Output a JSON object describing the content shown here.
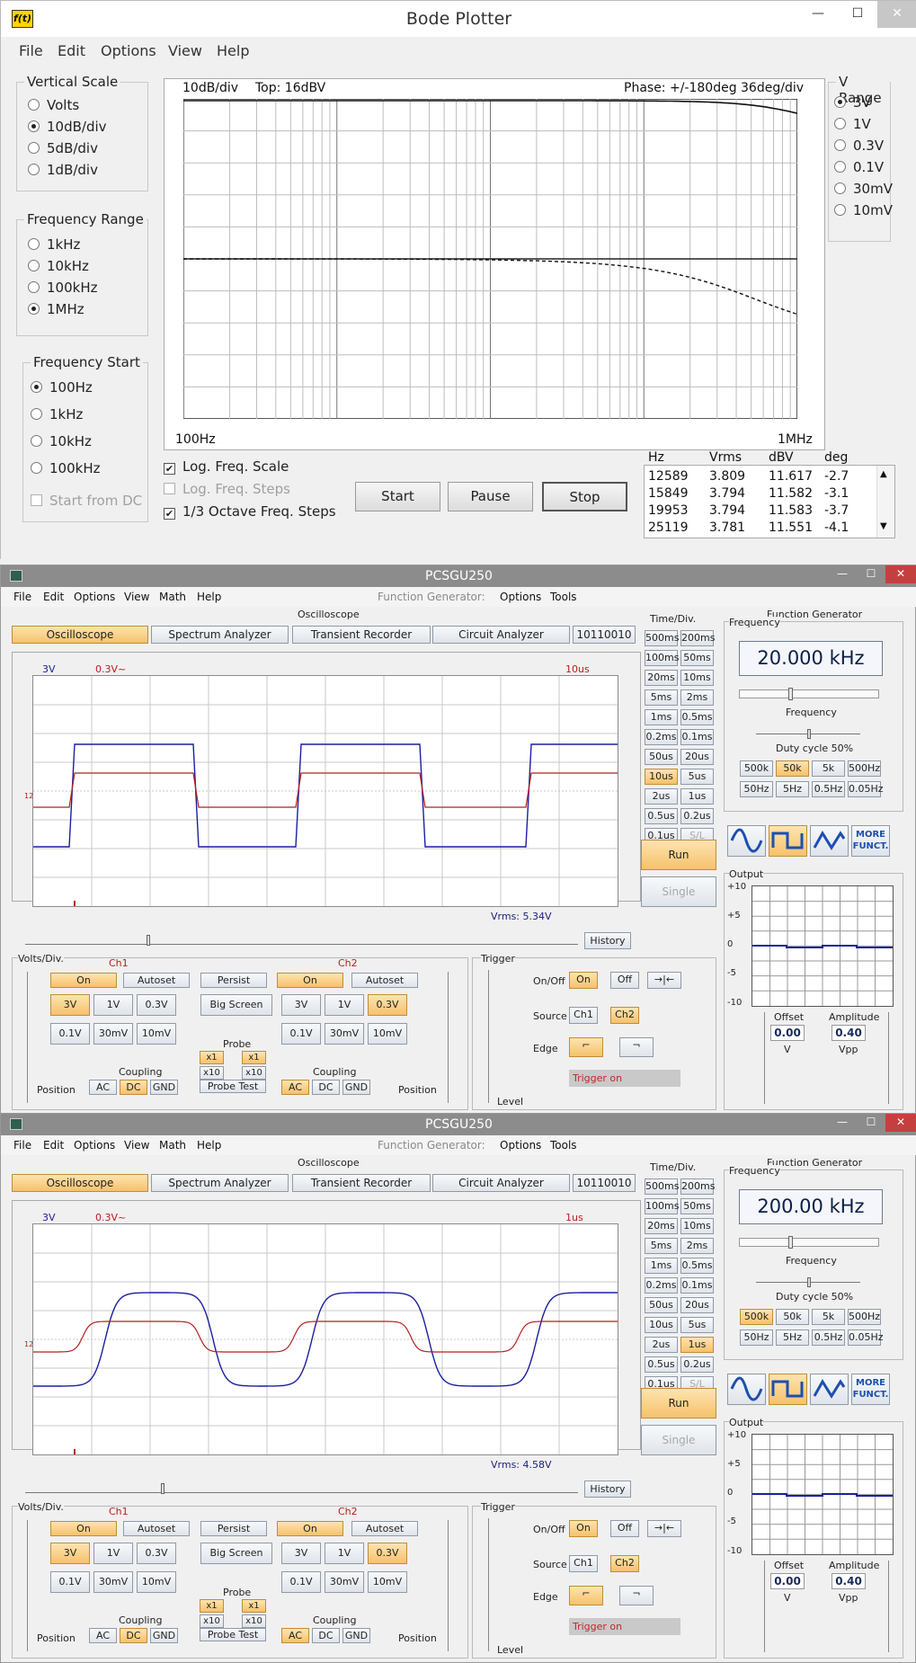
{
  "bode": {
    "title": "Bode Plotter",
    "icon_label": "f(t)",
    "window_buttons": {
      "minimize": "—",
      "maximize": "☐",
      "close": "✕"
    },
    "menu": [
      "File",
      "Edit",
      "Options",
      "View",
      "Help"
    ],
    "vertical_scale": {
      "label": "Vertical Scale",
      "options": [
        "Volts",
        "10dB/div",
        "5dB/div",
        "1dB/div"
      ],
      "selected": 1
    },
    "frequency_range": {
      "label": "Frequency Range",
      "options": [
        "1kHz",
        "10kHz",
        "100kHz",
        "1MHz"
      ],
      "selected": 3
    },
    "frequency_start": {
      "label": "Frequency Start",
      "options": [
        "100Hz",
        "1kHz",
        "10kHz",
        "100kHz"
      ],
      "selected": 0,
      "start_from_dc": "Start from DC"
    },
    "v_range": {
      "label": "V Range",
      "options": [
        "3V",
        "1V",
        "0.3V",
        "0.1V",
        "30mV",
        "10mV"
      ],
      "selected": 0
    },
    "plot": {
      "scale_text": "10dB/div",
      "top_text": "Top:  16dBV",
      "phase_text": "Phase: +/-180deg  36deg/div",
      "x_start": "100Hz",
      "x_end": "1MHz"
    },
    "checks": [
      {
        "label": "Log. Freq. Scale",
        "checked": true,
        "disabled": false
      },
      {
        "label": "Log. Freq. Steps",
        "checked": false,
        "disabled": true
      },
      {
        "label": "1/3 Octave Freq. Steps",
        "checked": true,
        "disabled": false
      }
    ],
    "buttons": {
      "start": "Start",
      "pause": "Pause",
      "stop": "Stop"
    },
    "table": {
      "headers": [
        "Hz",
        "Vrms",
        "dBV",
        "deg"
      ],
      "rows": [
        [
          "12589",
          "3.809",
          "11.617",
          "-2.7"
        ],
        [
          "15849",
          "3.794",
          "11.582",
          "-3.1"
        ],
        [
          "19953",
          "3.794",
          "11.583",
          "-3.7"
        ],
        [
          "25119",
          "3.781",
          "11.551",
          "-4.1"
        ]
      ]
    }
  },
  "pcs_common": {
    "title": "PCSGU250",
    "window_buttons": {
      "minimize": "—",
      "maximize": "☐",
      "close": "✕"
    },
    "menu": [
      "File",
      "Edit",
      "Options",
      "View",
      "Math",
      "Help"
    ],
    "fg_menu_label": "Function Generator:",
    "fg_menu": [
      "Options",
      "Tools"
    ],
    "osc_label": "Oscilloscope",
    "mode_buttons": [
      "Oscilloscope",
      "Spectrum Analyzer",
      "Transient Recorder",
      "Circuit Analyzer",
      "10110010"
    ],
    "timediv_label": "Time/Div.",
    "timediv": [
      [
        "500ms",
        "200ms"
      ],
      [
        "100ms",
        "50ms"
      ],
      [
        "20ms",
        "10ms"
      ],
      [
        "5ms",
        "2ms"
      ],
      [
        "1ms",
        "0.5ms"
      ],
      [
        "0.2ms",
        "0.1ms"
      ],
      [
        "50us",
        "20us"
      ],
      [
        "10us",
        "5us"
      ],
      [
        "2us",
        "1us"
      ],
      [
        "0.5us",
        "0.2us"
      ],
      [
        "0.1us",
        "S/L"
      ]
    ],
    "run": "Run",
    "single": "Single",
    "history": "History",
    "ch1_scale": "3V",
    "ch2_scale": "0.3V~",
    "volts_div": "Volts/Div.",
    "ch1": "Ch1",
    "ch2": "Ch2",
    "on": "On",
    "autoset": "Autoset",
    "persist": "Persist",
    "big_screen": "Big Screen",
    "volt_row1": [
      "3V",
      "1V",
      "0.3V"
    ],
    "volt_row2": [
      "0.1V",
      "30mV",
      "10mV"
    ],
    "probe": "Probe",
    "x1": "x1",
    "x10": "x10",
    "probe_test": "Probe Test",
    "coupling": "Coupling",
    "ac": "AC",
    "dc": "DC",
    "gnd": "GND",
    "position": "Position",
    "trigger": "Trigger",
    "onoff": "On/Off",
    "off": "Off",
    "source": "Source",
    "edge": "Edge",
    "level": "Level",
    "trigger_on": "Trigger on",
    "fg_title": "Function Generator",
    "frequency": "Frequency",
    "freq_slider_label": "Frequency",
    "duty": "Duty cycle 50%",
    "range_row1": [
      "500k",
      "50k",
      "5k",
      "500Hz"
    ],
    "range_row2": [
      "50Hz",
      "5Hz",
      "0.5Hz",
      "0.05Hz"
    ],
    "more": "MORE\nFUNCT.",
    "output": "Output",
    "output_ticks": [
      "+10",
      "+5",
      "0",
      "-5",
      "-10"
    ],
    "offset": "Offset",
    "offset_val": "0.00",
    "offset_unit": "V",
    "amplitude": "Amplitude",
    "amplitude_val": "0.40",
    "amplitude_unit": "Vpp",
    "colors": {
      "ch1": "#1b1fa0",
      "ch2": "#b81e1e",
      "accent": "#f6c16c"
    }
  },
  "pcs1": {
    "time_label": "10us",
    "vrms": "Vrms: 5.34V",
    "freq_display": "20.000 kHz",
    "selected_timediv": "10us",
    "selected_range": "50k"
  },
  "pcs2": {
    "time_label": "1us",
    "vrms": "Vrms: 4.58V",
    "freq_display": "200.00 kHz",
    "selected_timediv": "1us",
    "selected_range": "500k"
  }
}
